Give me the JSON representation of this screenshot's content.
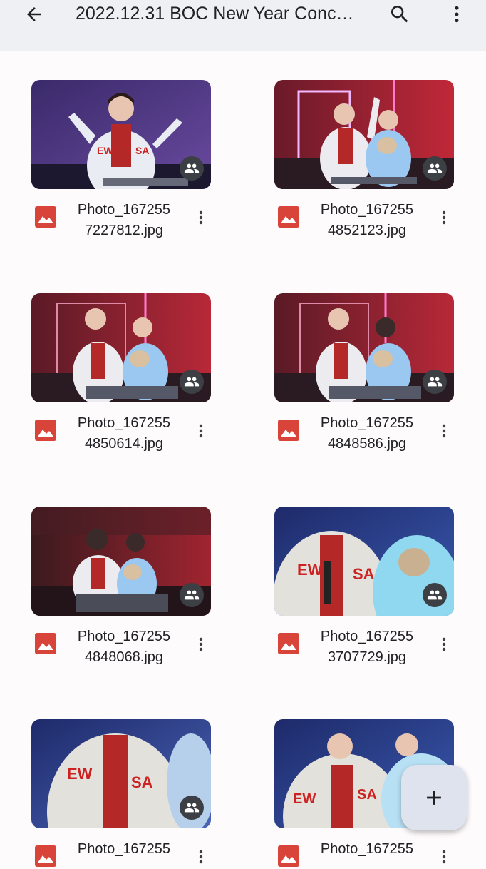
{
  "appbar": {
    "title": "2022.12.31 BOC New Year Conc…",
    "back_icon": "arrow-back-icon",
    "search_icon": "search-icon",
    "more_icon": "more-vert-icon"
  },
  "files": [
    {
      "name_line1": "Photo_167255",
      "name_line2": "7227812.jpg",
      "type_icon": "image-file-icon",
      "shared_icon": "people-icon"
    },
    {
      "name_line1": "Photo_167255",
      "name_line2": "4852123.jpg",
      "type_icon": "image-file-icon",
      "shared_icon": "people-icon"
    },
    {
      "name_line1": "Photo_167255",
      "name_line2": "4850614.jpg",
      "type_icon": "image-file-icon",
      "shared_icon": "people-icon"
    },
    {
      "name_line1": "Photo_167255",
      "name_line2": "4848586.jpg",
      "type_icon": "image-file-icon",
      "shared_icon": "people-icon"
    },
    {
      "name_line1": "Photo_167255",
      "name_line2": "4848068.jpg",
      "type_icon": "image-file-icon",
      "shared_icon": "people-icon"
    },
    {
      "name_line1": "Photo_167255",
      "name_line2": "3707729.jpg",
      "type_icon": "image-file-icon",
      "shared_icon": "people-icon"
    },
    {
      "name_line1": "Photo_167255",
      "name_line2": "",
      "type_icon": "image-file-icon",
      "shared_icon": "people-icon"
    },
    {
      "name_line1": "Photo_167255",
      "name_line2": "",
      "type_icon": "image-file-icon",
      "shared_icon": "people-icon"
    }
  ],
  "fab": {
    "icon": "add-icon"
  },
  "colors": {
    "appbar_bg": "#eef0f4",
    "page_bg": "#fefbfd",
    "image_icon_red": "#d9443a",
    "fab_bg": "#dee3ee",
    "text": "#202124"
  }
}
